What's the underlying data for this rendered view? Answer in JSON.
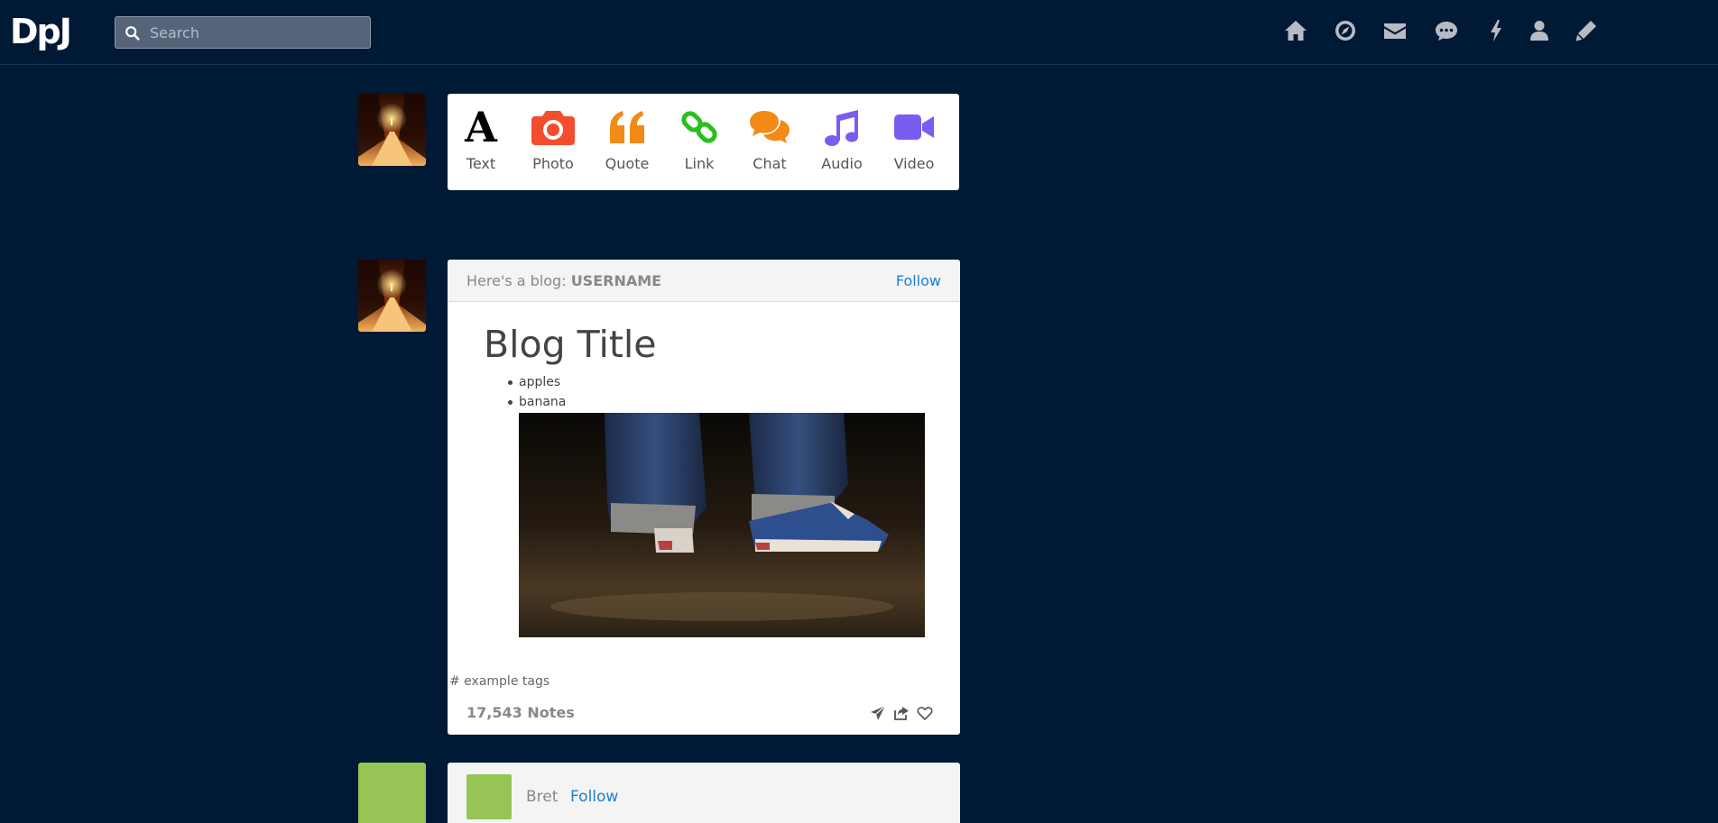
{
  "app": {
    "logo": "DpJ"
  },
  "search": {
    "placeholder": "Search",
    "value": ""
  },
  "nav": {
    "icons": [
      "home-icon",
      "compass-icon",
      "envelope-icon",
      "chat-bubble-icon",
      "lightning-icon",
      "user-icon",
      "pencil-icon"
    ]
  },
  "composer": {
    "types": [
      {
        "label": "Text",
        "icon": "text-icon",
        "color": "#000000"
      },
      {
        "label": "Photo",
        "icon": "camera-icon",
        "color": "#f24e2d"
      },
      {
        "label": "Quote",
        "icon": "quote-icon",
        "color": "#f28a16"
      },
      {
        "label": "Link",
        "icon": "link-icon",
        "color": "#29c01e"
      },
      {
        "label": "Chat",
        "icon": "chat-icon",
        "color": "#f28a16"
      },
      {
        "label": "Audio",
        "icon": "music-icon",
        "color": "#7b5cf2"
      },
      {
        "label": "Video",
        "icon": "video-camera-icon",
        "color": "#7b5cf2"
      }
    ]
  },
  "post": {
    "header_prefix": "Here's a blog:",
    "username": "USERNAME",
    "follow_label": "Follow",
    "title": "Blog Title",
    "list": [
      "apples",
      "banana"
    ],
    "tags": "# example tags",
    "notes": "17,543 Notes",
    "actions": [
      "send-icon",
      "share-icon",
      "heart-icon"
    ]
  },
  "post2": {
    "name": "Bret",
    "follow_label": "Follow"
  },
  "colors": {
    "background": "#001935",
    "accent": "#1a7fd6"
  }
}
